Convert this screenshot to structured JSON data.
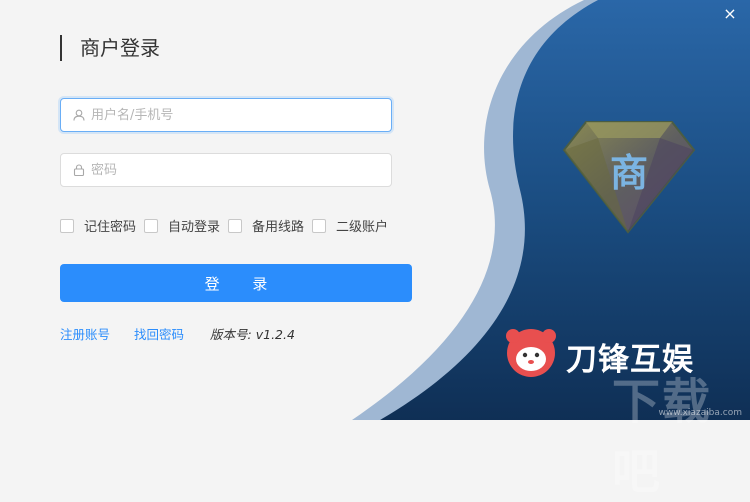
{
  "window": {
    "close_glyph": "×"
  },
  "login": {
    "title": "商户登录",
    "username_placeholder": "用户名/手机号",
    "password_placeholder": "密码",
    "options": [
      "记住密码",
      "自动登录",
      "备用线路",
      "二级账户"
    ],
    "submit_label": "登 录",
    "register_link": "注册账号",
    "recover_link": "找回密码",
    "version": "版本号: v1.2.4"
  },
  "brand": {
    "logo_char": "商",
    "text": "刀锋互娱",
    "watermark": "下载吧",
    "watermark_url": "www.xiazaiba.com"
  },
  "colors": {
    "accent": "#2b8dfc",
    "panel_dark": "#1b4f86",
    "background": "#f4f4f4"
  },
  "icons": {
    "username": "user-icon",
    "password": "lock-icon",
    "close": "close-icon",
    "logo": "diamond-logo-icon",
    "mascot": "lion-mascot-icon"
  }
}
